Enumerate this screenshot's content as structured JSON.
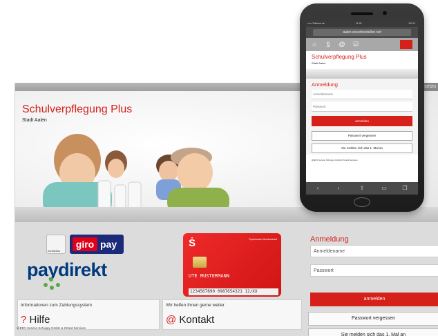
{
  "desktop": {
    "brand_title": "Schulverpflegung Plus",
    "brand_subtitle": "Stadt Aalen",
    "topbar_right": "Voraussetzu",
    "payment_logos": {
      "kontaktlos": "kontaktlos",
      "girogo": "girogo",
      "giropay_a": "giro",
      "giropay_b": "pay",
      "paydirekt_a": "pay",
      "paydirekt_b": "direkt"
    },
    "bank_card": {
      "holder": "UTE MUSTERMANN",
      "number": "1234567890   0987654321   12/XX",
      "brand_top": "Sparkasse Musterstadt"
    },
    "info": {
      "label": "Informationen zum Zahlungssystem",
      "link": "Hilfe",
      "symbol": "?"
    },
    "contact": {
      "label": "Wir helfen Ihnen gerne weiter",
      "link": "Kontakt",
      "symbol": "@"
    },
    "login": {
      "title": "Anmeldung",
      "username_placeholder": "Anmeldename",
      "password_placeholder": "Passwort",
      "submit": "anmelden",
      "forgot": "Passwort vergessen",
      "register": "Sie melden sich das 1. Mal an"
    },
    "footer": "@EDV Service Schuppy GmbH & SCard Services"
  },
  "phone": {
    "status_left": "••••• Telekom.de",
    "status_time": "11:25",
    "status_right": "100 %",
    "url": "aalen.essenbestellen.net",
    "brand_title": "Schulverpflegung Plus",
    "brand_subtitle": "Stadt Aalen",
    "login": {
      "title": "Anmeldung",
      "username_placeholder": "Anmeldename",
      "password_placeholder": "Passwort",
      "submit": "anmelden",
      "forgot": "Passwort vergessen",
      "register": "Sie melden sich das 1. Mal an"
    },
    "footer": "@EDV Service Schuppy GmbH & SCard Services",
    "nav_icons": [
      "home-icon",
      "paragraph-icon",
      "at-icon",
      "checkbox-icon"
    ],
    "toolbar_icons": [
      "back-icon",
      "forward-icon",
      "share-icon",
      "bookmarks-icon",
      "tabs-icon"
    ]
  },
  "colors": {
    "accent": "#d6201a",
    "paydirekt_blue": "#003a7d",
    "paydirekt_green": "#5aa845"
  }
}
